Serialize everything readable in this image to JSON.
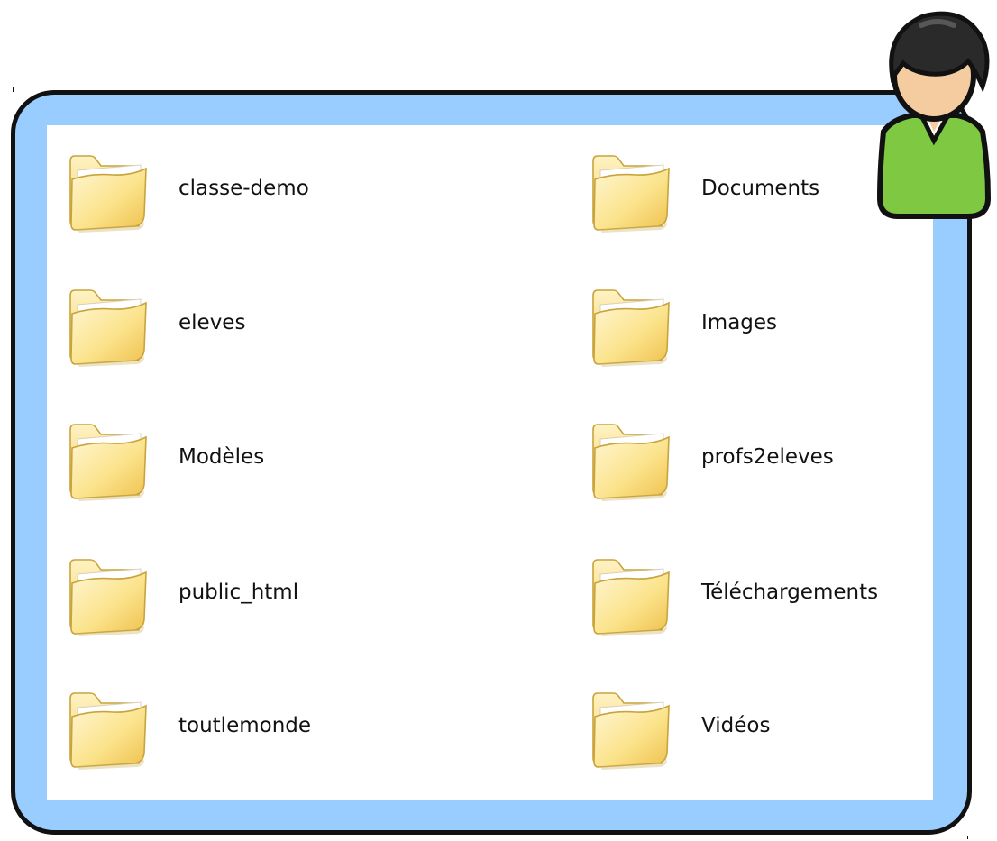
{
  "window": {
    "colors": {
      "frame_fill": "#99ccff",
      "frame_border": "#111111",
      "content_background": "#ffffff",
      "folder_yellow": "#fbe38c",
      "avatar_shirt": "#7ec842",
      "avatar_skin": "#f5cba0",
      "avatar_hair": "#2a2a2a"
    }
  },
  "avatar": {
    "icon": "user-avatar-icon"
  },
  "folders": [
    {
      "label": "classe-demo",
      "icon": "folder-icon"
    },
    {
      "label": "Documents",
      "icon": "folder-icon"
    },
    {
      "label": "eleves",
      "icon": "folder-icon"
    },
    {
      "label": "Images",
      "icon": "folder-icon"
    },
    {
      "label": "Modèles",
      "icon": "folder-icon"
    },
    {
      "label": "profs2eleves",
      "icon": "folder-icon"
    },
    {
      "label": "public_html",
      "icon": "folder-icon"
    },
    {
      "label": "Téléchargements",
      "icon": "folder-icon"
    },
    {
      "label": "toutlemonde",
      "icon": "folder-icon"
    },
    {
      "label": "Vidéos",
      "icon": "folder-icon"
    }
  ]
}
